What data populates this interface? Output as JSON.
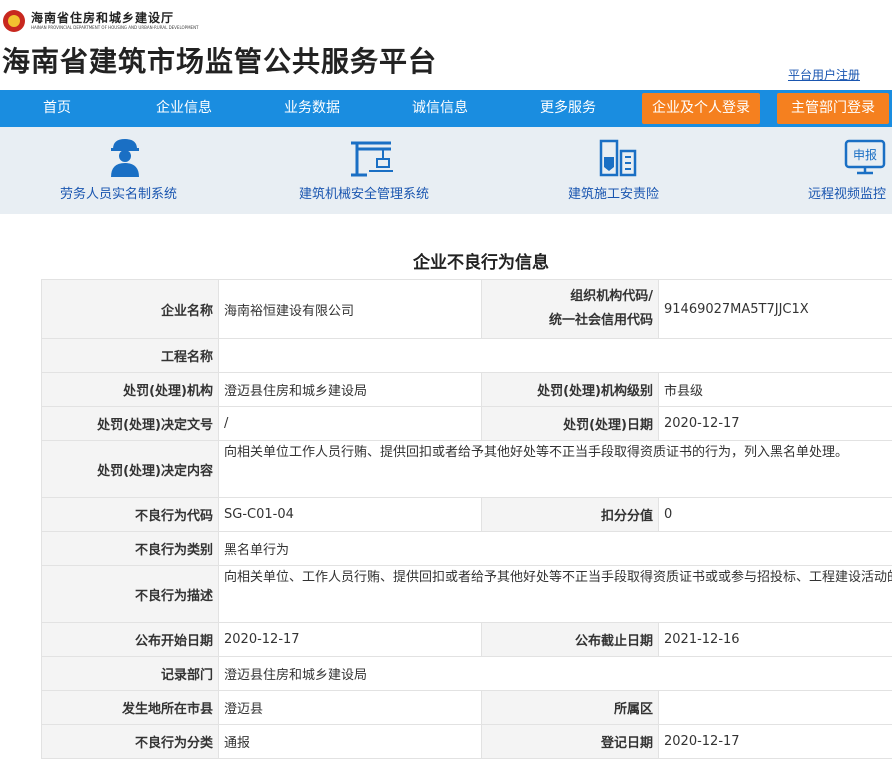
{
  "header": {
    "dept_name_cn": "海南省住房和城乡建设厅",
    "dept_name_en": "HAINAN PROVINCIAL DEPARTMENT OF HOUSING AND URBAN-RURAL DEVELOPMENT",
    "site_title": "海南省建筑市场监管公共服务平台",
    "register_link": "平台用户注册"
  },
  "nav": {
    "items": [
      "首页",
      "企业信息",
      "业务数据",
      "诚信信息",
      "更多服务"
    ],
    "login_button": "企业及个人登录",
    "admin_button": "主管部门登录",
    "color": "#1a8de0",
    "button_color": "#f5801f"
  },
  "systems": [
    {
      "label": "劳务人员实名制系统",
      "icon": "worker-icon"
    },
    {
      "label": "建筑机械安全管理系统",
      "icon": "tower-crane-icon"
    },
    {
      "label": "建筑施工安责险",
      "icon": "building-shield-icon"
    },
    {
      "label": "远程视频监控",
      "icon": "monitor-report-icon",
      "icon_text": "申报"
    }
  ],
  "page_title": "企业不良行为信息",
  "record": {
    "company_name_label": "企业名称",
    "company_name": "海南裕恒建设有限公司",
    "org_code_label_1": "组织机构代码/",
    "org_code_label_2": "统一社会信用代码",
    "org_code": "91469027MA5T7JJC1X",
    "project_name_label": "工程名称",
    "project_name": "",
    "penalty_org_label": "处罚(处理)机构",
    "penalty_org": "澄迈县住房和城乡建设局",
    "penalty_org_level_label": "处罚(处理)机构级别",
    "penalty_org_level": "市县级",
    "decision_doc_label": "处罚(处理)决定文号",
    "decision_doc": "/",
    "penalty_date_label": "处罚(处理)日期",
    "penalty_date": "2020-12-17",
    "decision_content_label": "处罚(处理)决定内容",
    "decision_content": "向相关单位工作人员行贿、提供回扣或者给予其他好处等不正当手段取得资质证书的行为，列入黑名单处理。",
    "behavior_code_label": "不良行为代码",
    "behavior_code": "SG-C01-04",
    "deduct_score_label": "扣分分值",
    "deduct_score": "0",
    "behavior_category_label": "不良行为类别",
    "behavior_category": "黑名单行为",
    "behavior_desc_label": "不良行为描述",
    "behavior_desc": "向相关单位、工作人员行贿、提供回扣或者给予其他好处等不正当手段取得资质证书或或参与招投标、工程建设活动的",
    "publish_start_label": "公布开始日期",
    "publish_start": "2020-12-17",
    "publish_end_label": "公布截止日期",
    "publish_end": "2021-12-16",
    "record_dept_label": "记录部门",
    "record_dept": "澄迈县住房和城乡建设局",
    "location_city_label": "发生地所在市县",
    "location_city": "澄迈县",
    "district_label": "所属区",
    "district": "",
    "behavior_class_label": "不良行为分类",
    "behavior_class": "通报",
    "register_date_label": "登记日期",
    "register_date": "2020-12-17"
  }
}
